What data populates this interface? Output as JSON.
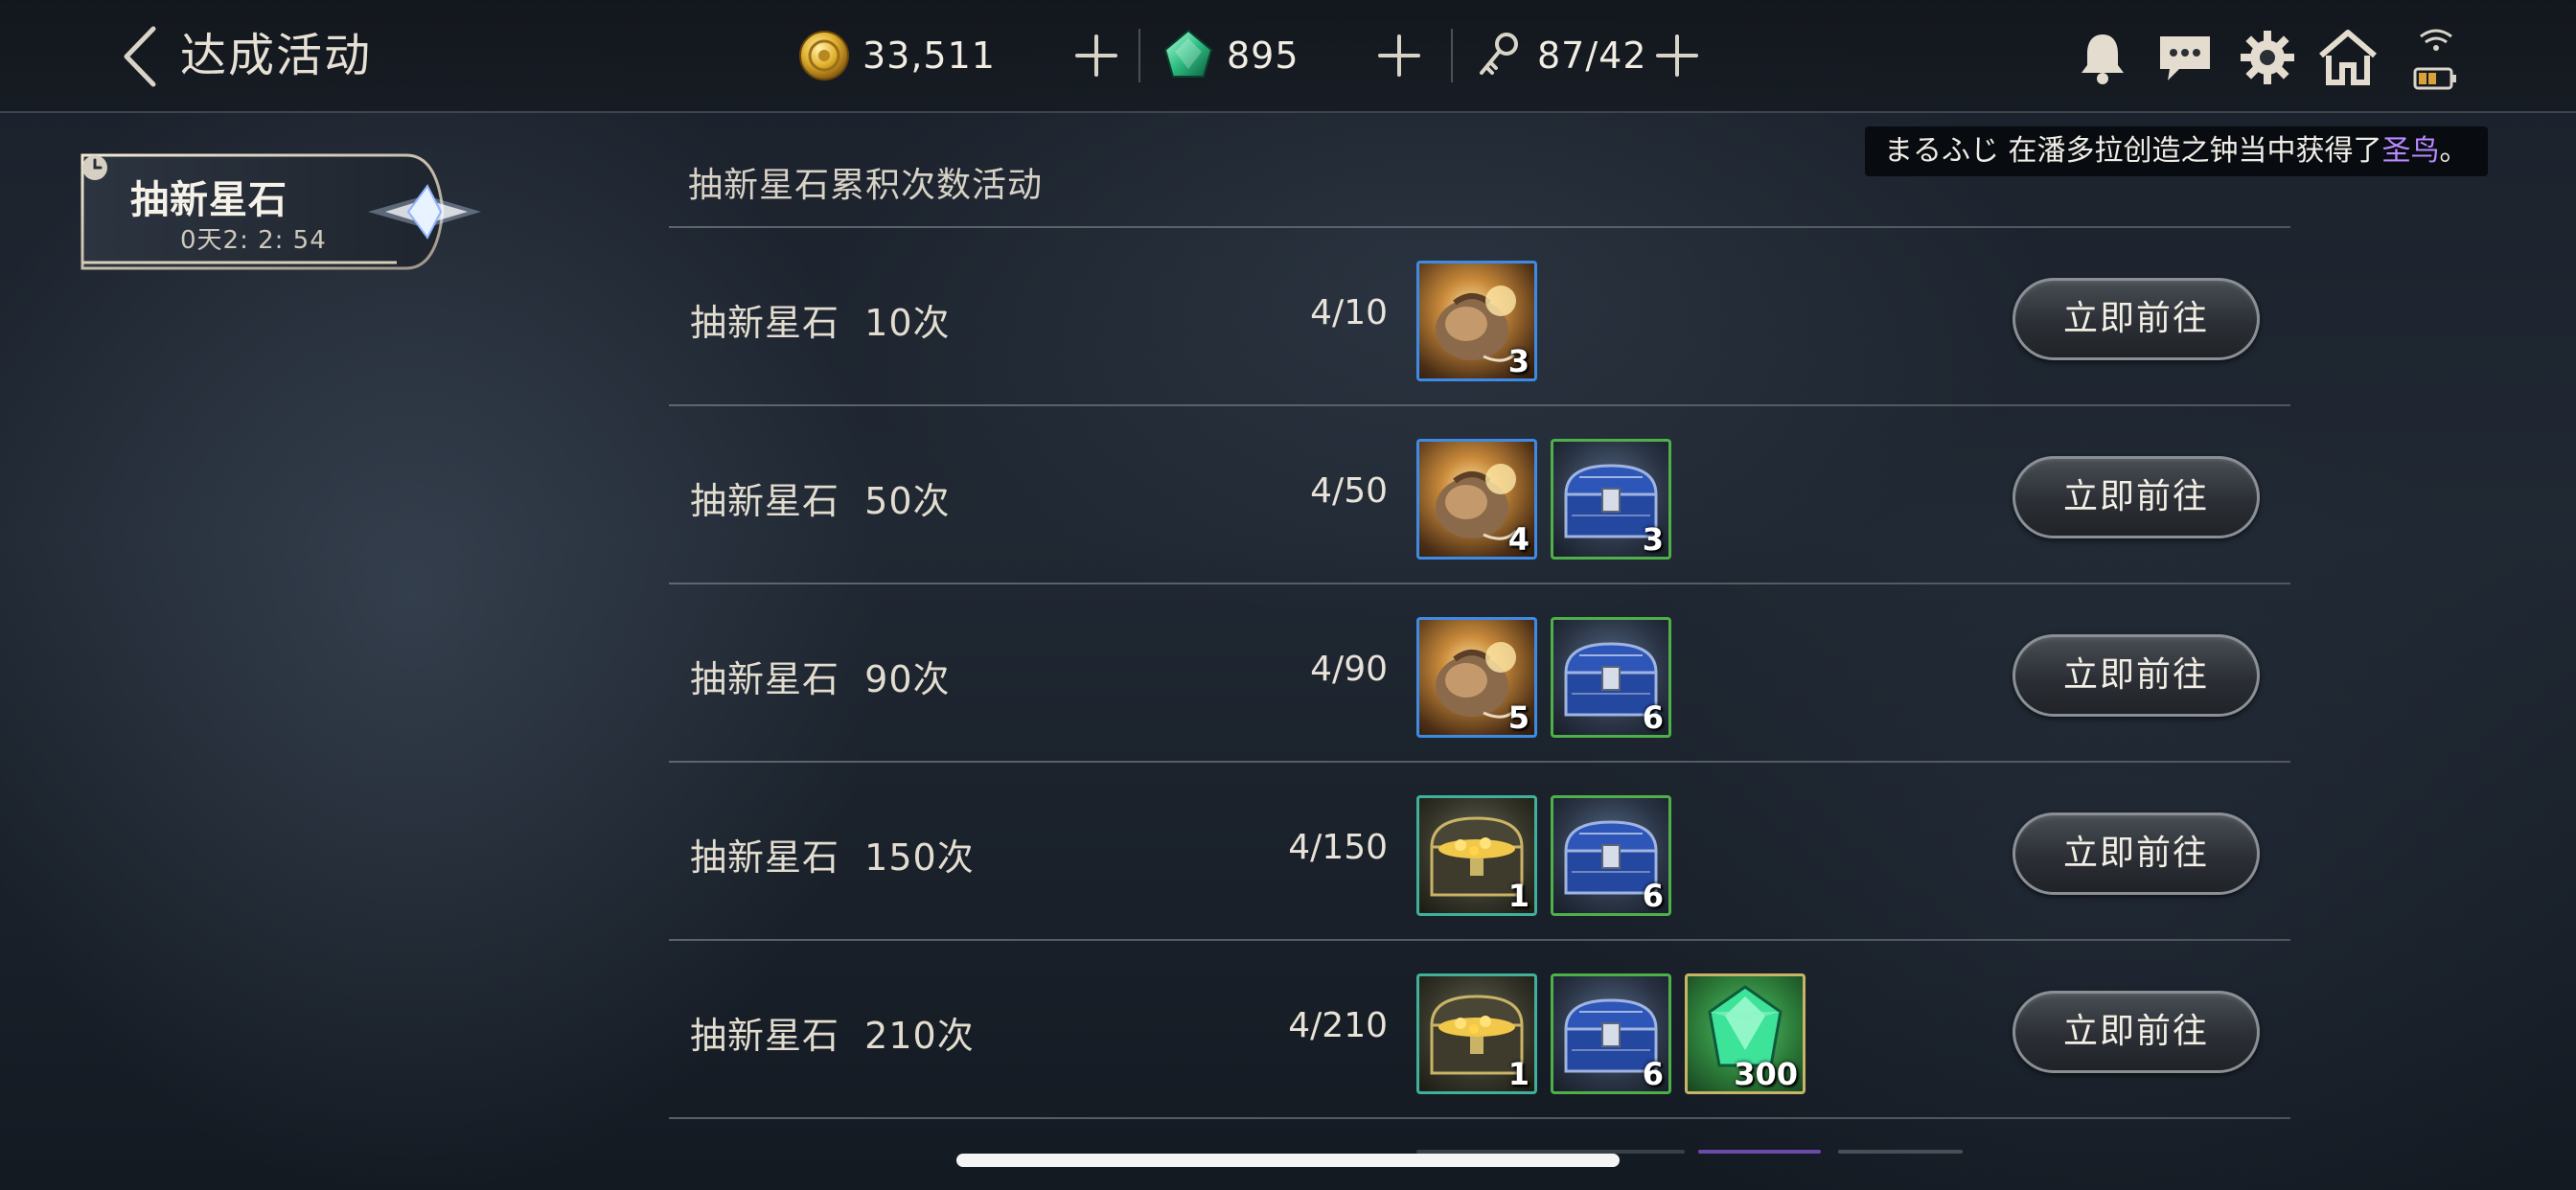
{
  "header": {
    "title": "达成活动",
    "gold": "33,511",
    "gems": "895",
    "keys": "87/42"
  },
  "broadcast": {
    "player": "まるふじ",
    "middle": "在潘多拉创造之钟当中获得了",
    "item": "圣鸟",
    "end": "。"
  },
  "sidebar": {
    "tab_title": "抽新星石",
    "timer": "0天2: 2: 54"
  },
  "main": {
    "section_title": "抽新星石累积次数活动",
    "go_label": "立即前往",
    "rows": [
      {
        "label": "抽新星石  10次",
        "progress": "4/10",
        "rewards": [
          {
            "icon": "pouch-icon",
            "count": "3"
          }
        ]
      },
      {
        "label": "抽新星石  50次",
        "progress": "4/50",
        "rewards": [
          {
            "icon": "pouch-icon",
            "count": "4"
          },
          {
            "icon": "blue-chest-icon",
            "count": "3"
          }
        ]
      },
      {
        "label": "抽新星石  90次",
        "progress": "4/90",
        "rewards": [
          {
            "icon": "pouch-icon",
            "count": "5"
          },
          {
            "icon": "blue-chest-icon",
            "count": "6"
          }
        ]
      },
      {
        "label": "抽新星石  150次",
        "progress": "4/150",
        "rewards": [
          {
            "icon": "gold-chest-icon",
            "count": "1"
          },
          {
            "icon": "blue-chest-icon",
            "count": "6"
          }
        ]
      },
      {
        "label": "抽新星石  210次",
        "progress": "4/210",
        "rewards": [
          {
            "icon": "gold-chest-icon",
            "count": "1"
          },
          {
            "icon": "blue-chest-icon",
            "count": "6"
          },
          {
            "icon": "green-gem-icon",
            "count": "300"
          }
        ]
      }
    ]
  },
  "colors": {
    "accent_purple": "#b889ff",
    "frame_blue": "#3d8be6",
    "frame_green": "#4fb04a",
    "frame_teal": "#3fb09a",
    "frame_gold": "#c9b466"
  }
}
